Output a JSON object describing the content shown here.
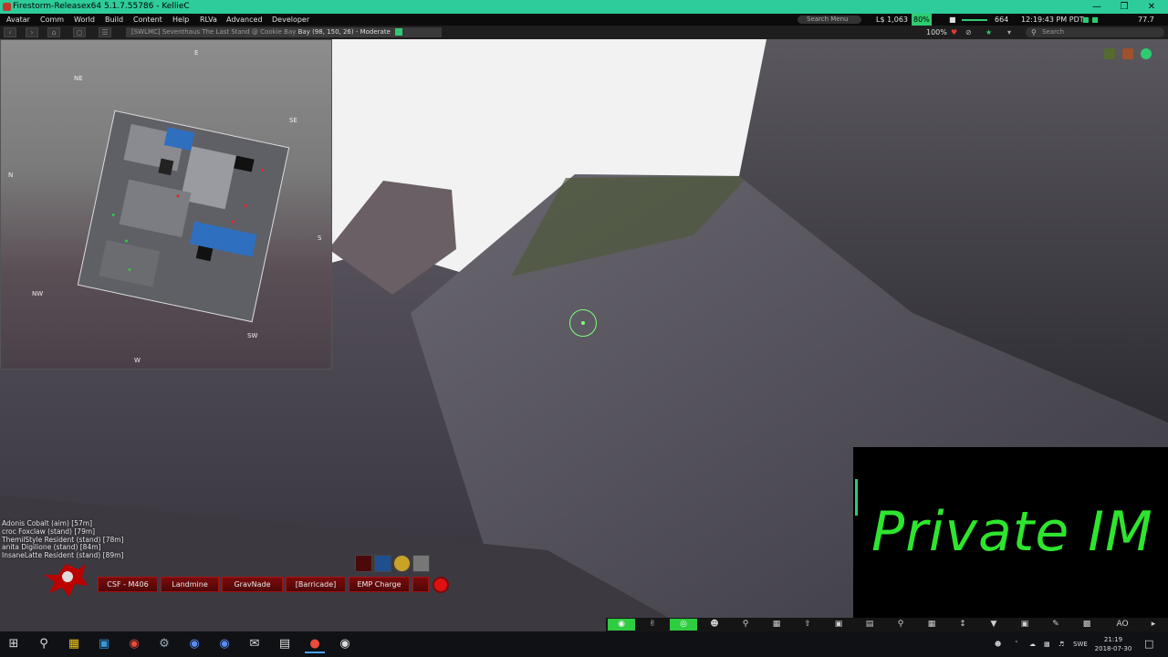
{
  "window": {
    "title": "Firestorm-Releasex64 5.1.7.55786 - KellieC",
    "minimize": "—",
    "restore": "❐",
    "close": "✕"
  },
  "menu": {
    "items": [
      "Avatar",
      "Comm",
      "World",
      "Build",
      "Content",
      "Help",
      "RLVa",
      "Advanced",
      "Developer"
    ],
    "search_placeholder": "Search Menu",
    "balance": "L$ 1,063",
    "percent": "80%",
    "fps": "664",
    "time": "12:19:43 PM PDT",
    "right_value": "77.7"
  },
  "navbar": {
    "location_dim": "[SWLMC] Seventhaus  The Last Stand @ Cookie Bay",
    "location_bright": "Bay (98, 150, 26) - Moderate",
    "zoom": "100%",
    "search_placeholder": "Search"
  },
  "minimap": {
    "compass": {
      "n": "N",
      "ne": "NE",
      "e": "E",
      "se": "SE",
      "s": "S",
      "sw": "SW",
      "w": "W",
      "nw": "NW"
    }
  },
  "nearby": [
    "Adonis Cobalt (aim) [57m]",
    "croc Foxclaw (stand) [79m]",
    "ThemilStyle Resident (stand) [78m]",
    "anita Digilione (stand) [84m]",
    "InsaneLatte Resident (stand) [89m]"
  ],
  "weapons": [
    "CSF - M406",
    "Landmine",
    "GravNade",
    "[Barricade]",
    "EMP Charge"
  ],
  "private_im": "Private IM",
  "taskbar": {
    "lang": "SWE",
    "time": "21:19",
    "date": "2018-07-30"
  },
  "colors": {
    "accent_green": "#2ecc71",
    "weapon_red": "#7a0b0b",
    "titlebar": "#2ecc9a"
  },
  "icons": {
    "bottom_toolbar": [
      "chat-icon",
      "gesture-icon",
      "voice-icon",
      "people-icon",
      "places-icon",
      "inventory-icon",
      "move-icon",
      "camera-icon",
      "view-icon",
      "search-icon",
      "map-icon",
      "walk-icon",
      "destination-icon",
      "snapshot-icon",
      "build-icon",
      "sound-icon",
      "ao-icon"
    ]
  },
  "toolbar": {
    "ao_label": "AO"
  }
}
